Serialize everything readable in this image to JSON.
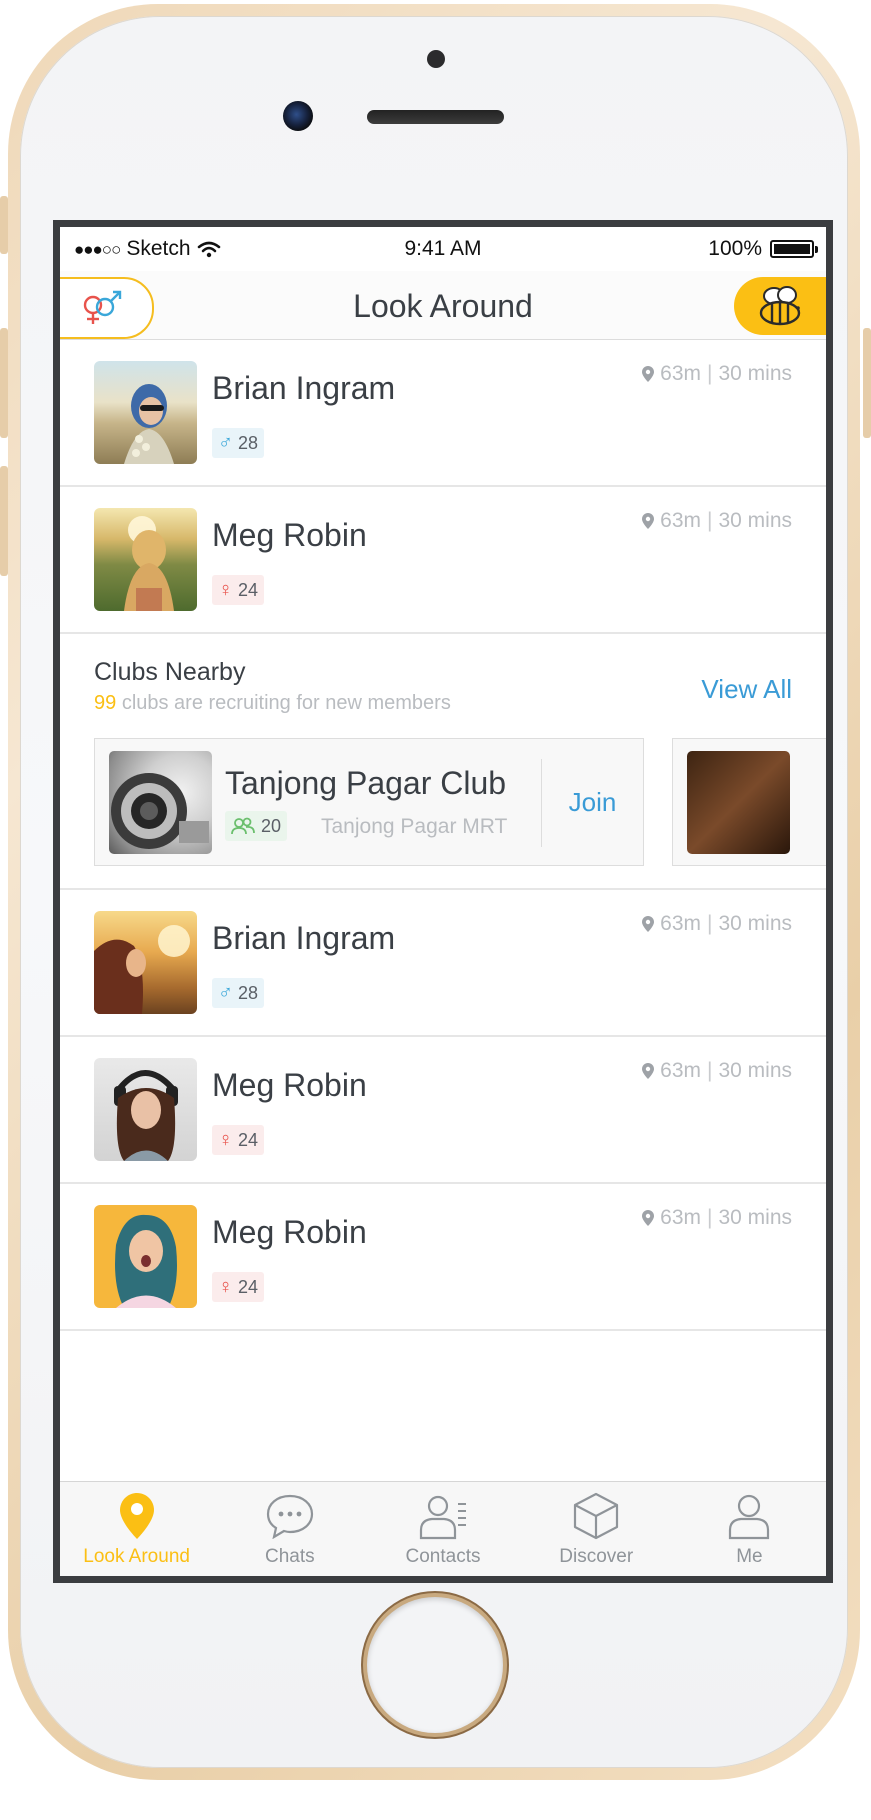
{
  "status_bar": {
    "carrier": "Sketch",
    "time": "9:41 AM",
    "battery": "100%"
  },
  "nav": {
    "title": "Look Around"
  },
  "people_top": [
    {
      "name": "Brian Ingram",
      "distance": "63m",
      "time": "30 mins",
      "gender": "male",
      "gender_symbol": "♂",
      "age": "28"
    },
    {
      "name": "Meg Robin",
      "distance": "63m",
      "time": "30 mins",
      "gender": "female",
      "gender_symbol": "♀",
      "age": "24"
    }
  ],
  "clubs": {
    "title": "Clubs Nearby",
    "count": "99",
    "subtitle": "clubs are recruiting for new members",
    "view_all": "View All",
    "card": {
      "name": "Tanjong Pagar Club",
      "members": "20",
      "location": "Tanjong Pagar MRT",
      "join": "Join"
    }
  },
  "people_bottom": [
    {
      "name": "Brian Ingram",
      "distance": "63m",
      "time": "30 mins",
      "gender": "male",
      "gender_symbol": "♂",
      "age": "28"
    },
    {
      "name": "Meg Robin",
      "distance": "63m",
      "time": "30 mins",
      "gender": "female",
      "gender_symbol": "♀",
      "age": "24"
    },
    {
      "name": "Meg Robin",
      "distance": "63m",
      "time": "30 mins",
      "gender": "female",
      "gender_symbol": "♀",
      "age": "24"
    }
  ],
  "tabs": [
    {
      "label": "Look Around",
      "icon": "location-pin-icon",
      "active": true
    },
    {
      "label": "Chats",
      "icon": "chat-bubble-icon",
      "active": false
    },
    {
      "label": "Contacts",
      "icon": "contacts-icon",
      "active": false
    },
    {
      "label": "Discover",
      "icon": "cube-icon",
      "active": false
    },
    {
      "label": "Me",
      "icon": "person-icon",
      "active": false
    }
  ],
  "colors": {
    "accent_yellow": "#fbbf14",
    "link_blue": "#3a9bd6",
    "male_blue": "#3aa7d9",
    "female_red": "#e8534c"
  }
}
